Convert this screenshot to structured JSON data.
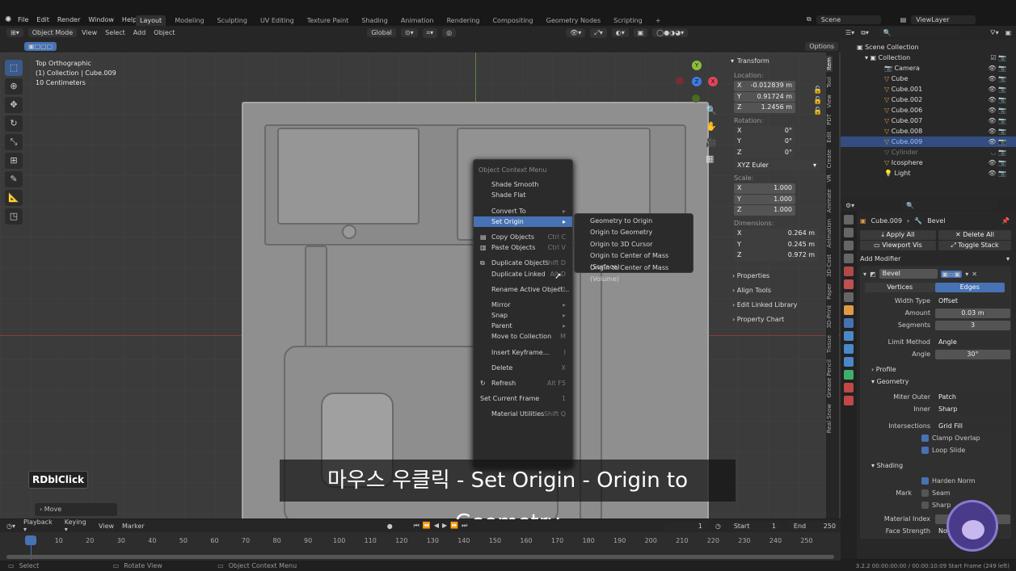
{
  "top_menu": {
    "items": [
      "File",
      "Edit",
      "Render",
      "Window",
      "Help"
    ]
  },
  "workspace_tabs": [
    "Layout",
    "Modeling",
    "Sculpting",
    "UV Editing",
    "Texture Paint",
    "Shading",
    "Animation",
    "Rendering",
    "Compositing",
    "Geometry Nodes",
    "Scripting"
  ],
  "workspace_add": "+",
  "scene": {
    "scene_name": "Scene",
    "view_layer": "ViewLayer"
  },
  "viewport_header": {
    "mode": "Object Mode",
    "menus": [
      "View",
      "Select",
      "Add",
      "Object"
    ],
    "transform_orientation": "Global",
    "options": "Options"
  },
  "viewport_info": {
    "line1": "Top Orthographic",
    "line2": "(1) Collection | Cube.009",
    "line3": "10 Centimeters"
  },
  "gizmo": {
    "x": "X",
    "y": "Y",
    "z": "Z"
  },
  "context_menu": {
    "title": "Object Context Menu",
    "items": [
      {
        "label": "Shade Smooth",
        "shortcut": ""
      },
      {
        "label": "Shade Flat",
        "shortcut": ""
      },
      {
        "label": "Convert To",
        "shortcut": "▸"
      },
      {
        "label": "Set Origin",
        "shortcut": "▸"
      },
      {
        "label": "Copy Objects",
        "shortcut": "Ctrl C"
      },
      {
        "label": "Paste Objects",
        "shortcut": "Ctrl V"
      },
      {
        "label": "Duplicate Objects",
        "shortcut": "Shift D"
      },
      {
        "label": "Duplicate Linked",
        "shortcut": "Alt D"
      },
      {
        "label": "Rename Active Object...",
        "shortcut": "F2"
      },
      {
        "label": "Mirror",
        "shortcut": "▸"
      },
      {
        "label": "Snap",
        "shortcut": "▸"
      },
      {
        "label": "Parent",
        "shortcut": "▸"
      },
      {
        "label": "Move to Collection",
        "shortcut": "M"
      },
      {
        "label": "Insert Keyframe...",
        "shortcut": "I"
      },
      {
        "label": "Delete",
        "shortcut": "X"
      },
      {
        "label": "Refresh",
        "shortcut": "Alt F5"
      },
      {
        "label": "Set Current Frame",
        "shortcut": "1"
      },
      {
        "label": "Material Utilities",
        "shortcut": "Shift Q"
      }
    ]
  },
  "set_origin_submenu": [
    "Geometry to Origin",
    "Origin to Geometry",
    "Origin to 3D Cursor",
    "Origin to Center of Mass (Surface)",
    "Origin to Center of Mass (Volume)"
  ],
  "caption": "마우스 우클릭 - Set Origin - Origin to Geometry",
  "key_overlay": "RDblClick",
  "last_operator": "Move",
  "transform_panel": {
    "title": "Transform",
    "location_label": "Location:",
    "location": {
      "x": "-0.012839 m",
      "y": "0.91724 m",
      "z": "1.2456 m"
    },
    "rotation_label": "Rotation:",
    "rotation": {
      "x": "0°",
      "y": "0°",
      "z": "0°"
    },
    "rotation_mode": "XYZ Euler",
    "scale_label": "Scale:",
    "scale": {
      "x": "1.000",
      "y": "1.000",
      "z": "1.000"
    },
    "dimensions_label": "Dimensions:",
    "dimensions": {
      "x": "0.264 m",
      "y": "0.245 m",
      "z": "0.972 m"
    },
    "axis_x": "X",
    "axis_y": "Y",
    "axis_z": "Z"
  },
  "collapsed_panels": [
    "Properties",
    "Align Tools",
    "Edit Linked Library",
    "Property Chart"
  ],
  "viewport_side_tabs": [
    "Item",
    "Tool",
    "View",
    "PDT",
    "Edit",
    "Create",
    "VR",
    "Animate",
    "Animation",
    "3D-Cost",
    "Paper",
    "3D-Print",
    "Tissue",
    "Grease Pencil",
    "Real Snow"
  ],
  "outliner": {
    "root": "Scene Collection",
    "collection": "Collection",
    "objects": [
      {
        "name": "Camera",
        "state": "normal"
      },
      {
        "name": "Cube",
        "state": "normal"
      },
      {
        "name": "Cube.001",
        "state": "normal"
      },
      {
        "name": "Cube.002",
        "state": "normal"
      },
      {
        "name": "Cube.006",
        "state": "normal"
      },
      {
        "name": "Cube.007",
        "state": "normal"
      },
      {
        "name": "Cube.008",
        "state": "normal"
      },
      {
        "name": "Cube.009",
        "state": "selected"
      },
      {
        "name": "Cylinder",
        "state": "hidden"
      },
      {
        "name": "Icosphere",
        "state": "normal"
      },
      {
        "name": "Light",
        "state": "normal"
      }
    ]
  },
  "properties": {
    "object_name": "Cube.009",
    "modifier_crumb": "Bevel",
    "apply_all": "Apply All",
    "delete_all": "Delete All",
    "viewport_vis": "Viewport Vis",
    "toggle_stack": "Toggle Stack",
    "add_modifier": "Add Modifier",
    "modifier_name": "Bevel",
    "affect_vertices": "Vertices",
    "affect_edges": "Edges",
    "width_type_label": "Width Type",
    "width_type": "Offset",
    "amount_label": "Amount",
    "amount": "0.03 m",
    "segments_label": "Segments",
    "segments": "3",
    "limit_method_label": "Limit Method",
    "limit_method": "Angle",
    "angle_label": "Angle",
    "angle": "30°",
    "profile": "Profile",
    "geometry": "Geometry",
    "miter_outer_label": "Miter Outer",
    "miter_outer": "Patch",
    "inner_label": "Inner",
    "inner": "Sharp",
    "intersections_label": "Intersections",
    "intersections": "Grid Fill",
    "clamp_overlap": "Clamp Overlap",
    "loop_slide": "Loop Slide",
    "shading": "Shading",
    "harden_normals": "Harden Norm",
    "mark_label": "Mark",
    "seam": "Seam",
    "sharp": "Sharp",
    "material_index_label": "Material Index",
    "face_strength_label": "Face Strength",
    "face_strength": "None"
  },
  "timeline": {
    "menus": [
      "Playback",
      "Keying",
      "View",
      "Marker"
    ],
    "current_frame": "1",
    "start_label": "Start",
    "start": "1",
    "end_label": "End",
    "end": "250",
    "ticks": [
      "1",
      "10",
      "20",
      "30",
      "40",
      "50",
      "60",
      "70",
      "80",
      "90",
      "100",
      "110",
      "120",
      "130",
      "140",
      "150",
      "160",
      "170",
      "180",
      "190",
      "200",
      "210",
      "220",
      "230",
      "240",
      "250"
    ]
  },
  "statusbar": {
    "select": "Select",
    "rotate": "Rotate View",
    "context": "Object Context Menu",
    "version": "3.2.2 00:00:00:00 / 00:00:10:09 Start Frame (249 left)"
  },
  "colors": {
    "accent": "#4772b3",
    "bg": "#1d1d1d",
    "panel": "#282828"
  }
}
